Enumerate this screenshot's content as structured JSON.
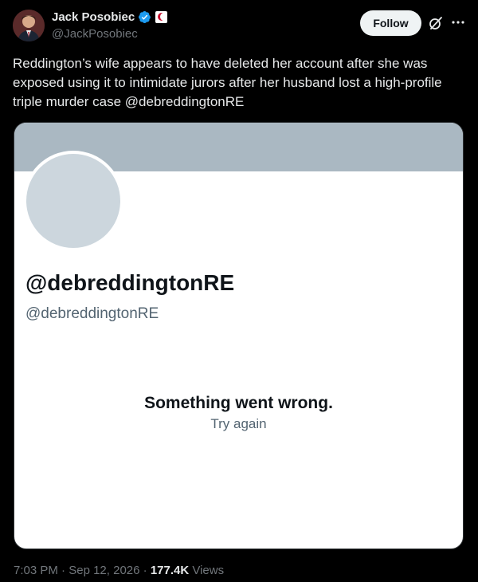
{
  "author": {
    "display_name": "Jack Posobiec",
    "handle": "@JackPosobiec",
    "follow_label": "Follow",
    "avatar_icon": "profile-photo",
    "badges": [
      "verified-badge-icon",
      "affiliate-flag-icon"
    ],
    "verified_color": "#1d9bf0"
  },
  "tweet": {
    "text": "Reddington’s wife appears to have deleted her account after she was exposed using it to intimidate jurors after her husband lost a high-profile triple murder case @debreddingtonRE"
  },
  "embedded_card": {
    "name": "@debreddingtonRE",
    "handle": "@debreddingtonRE",
    "error_title": "Something went wrong.",
    "retry_label": "Try again"
  },
  "meta": {
    "time": "7:03 PM",
    "separator": "·",
    "date": "Sep 12, 2026",
    "views_count": "177.4K",
    "views_label": "Views"
  },
  "colors": {
    "background": "#000000",
    "text_primary": "#e7e9ea",
    "text_secondary": "#71767b",
    "card_banner": "#aab8c2",
    "card_avatar": "#ccd6dd"
  }
}
